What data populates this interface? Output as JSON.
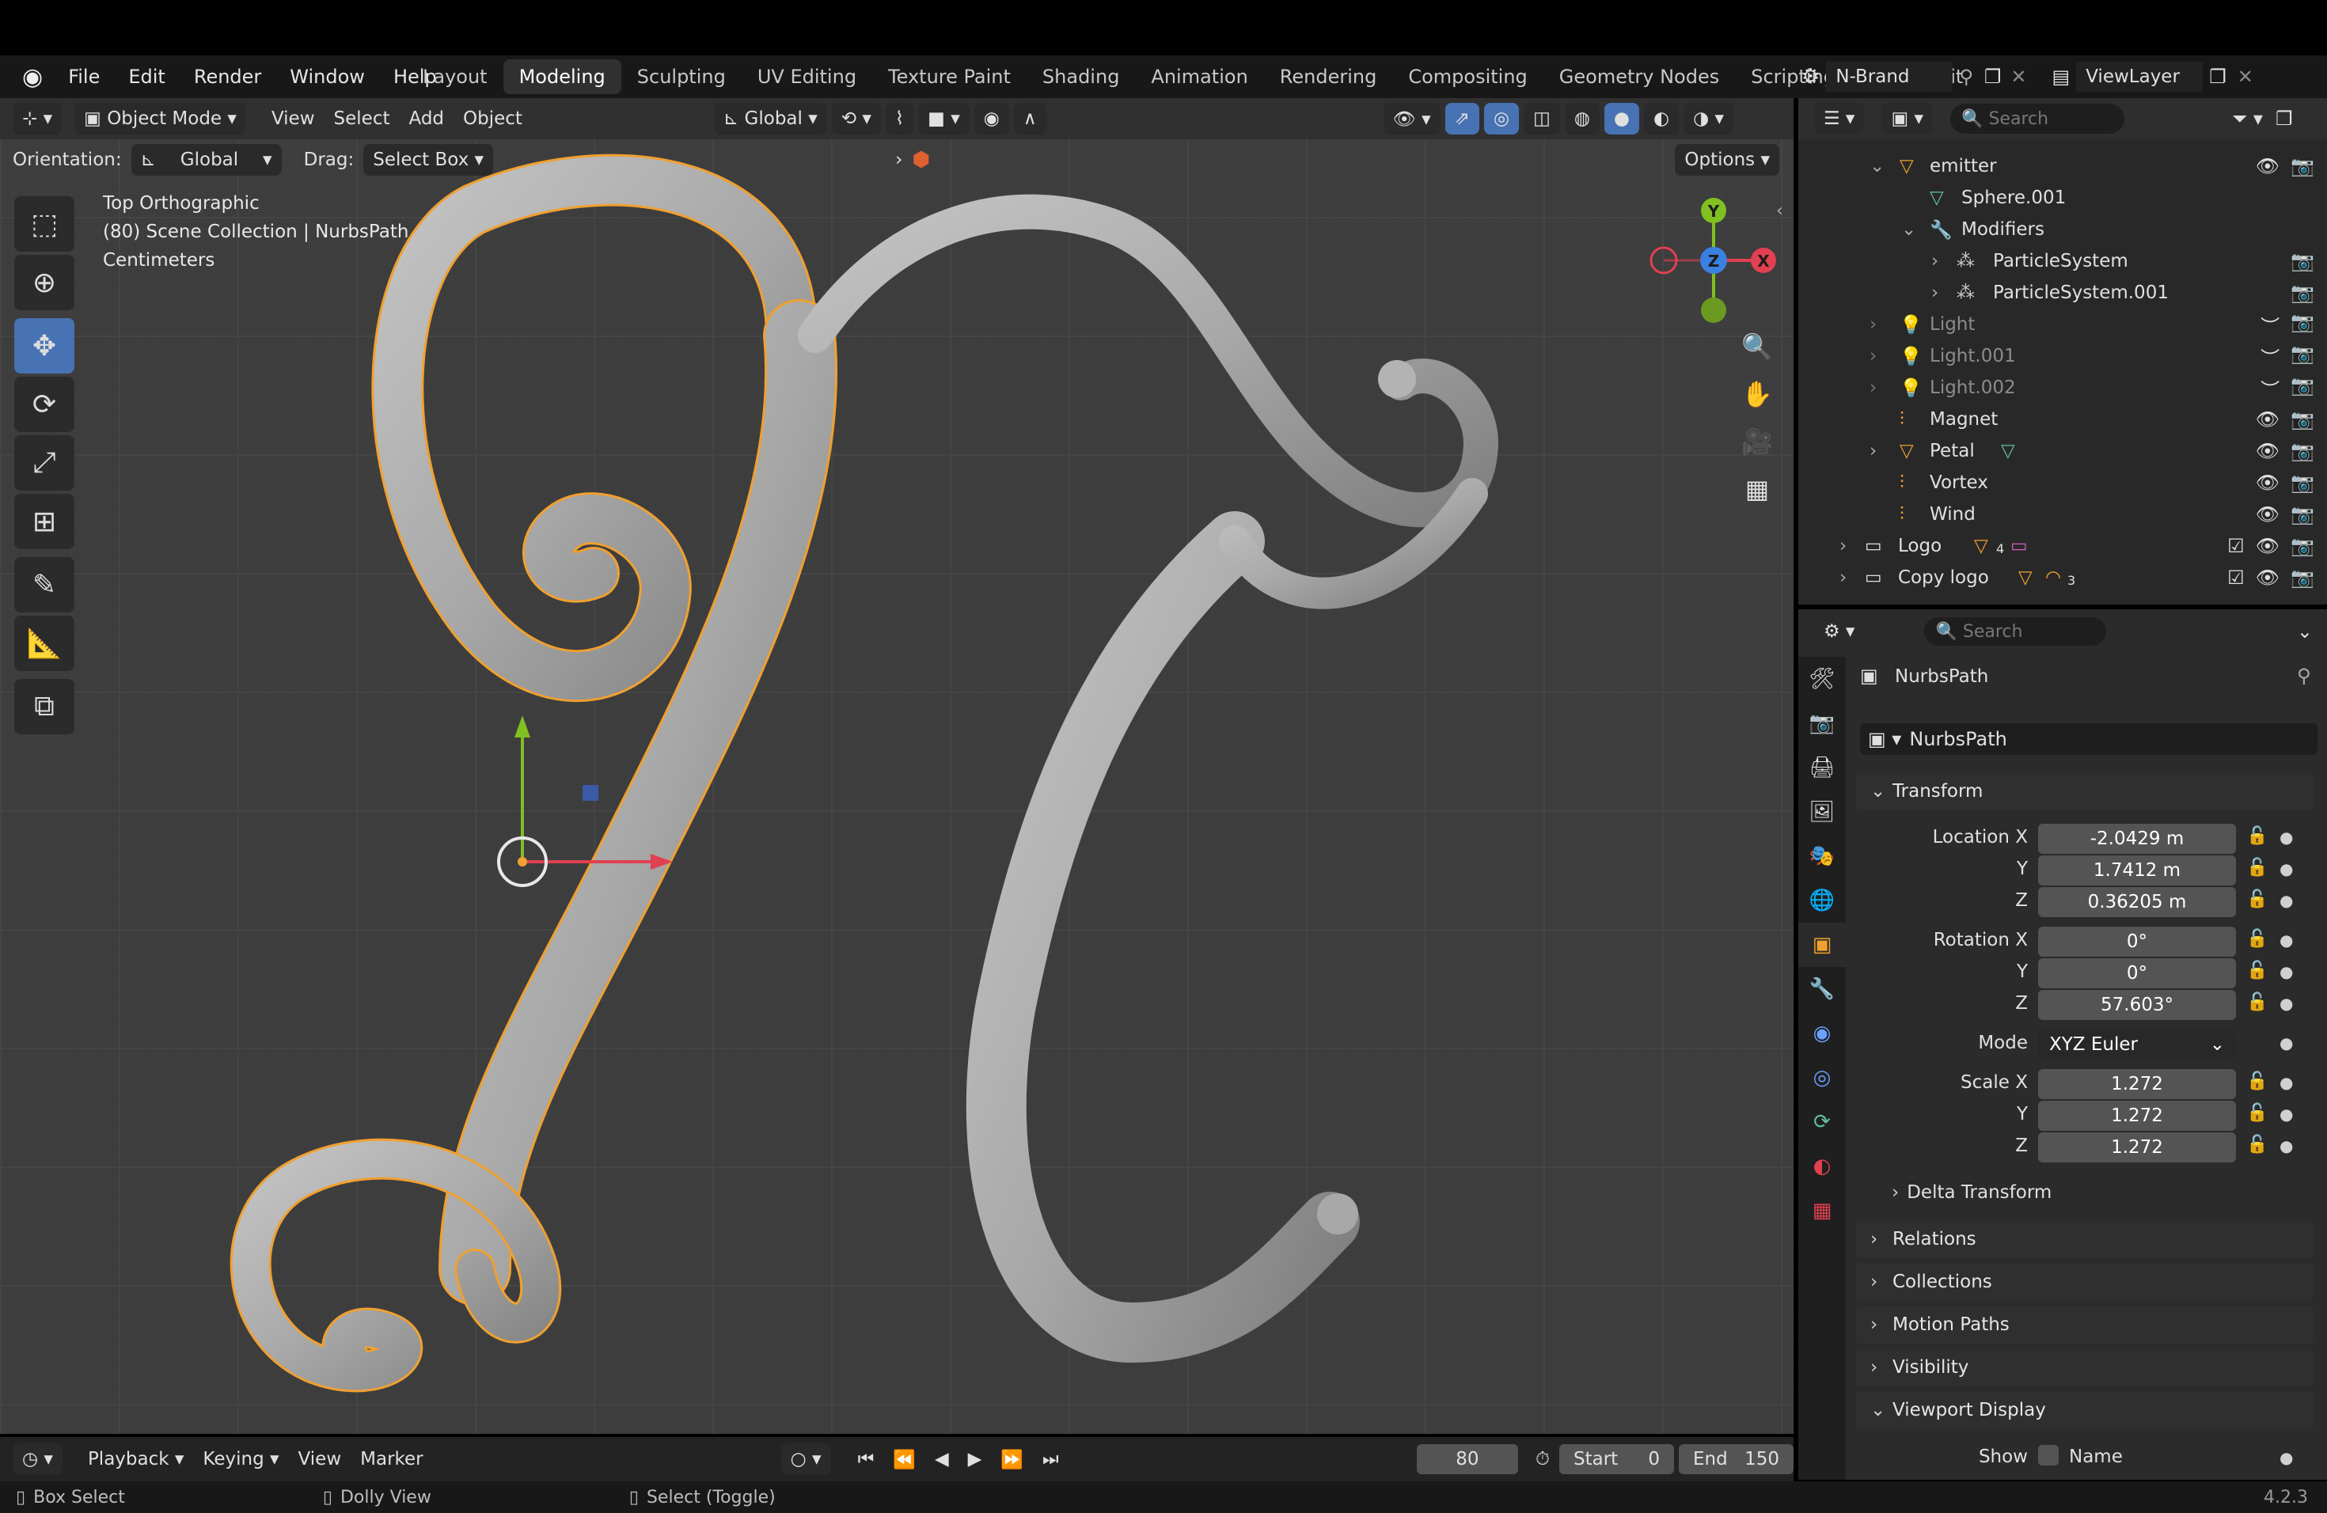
{
  "menus": [
    "File",
    "Edit",
    "Render",
    "Window",
    "Help"
  ],
  "workspaces": [
    "Layout",
    "Modeling",
    "Sculpting",
    "UV Editing",
    "Texture Paint",
    "Shading",
    "Animation",
    "Rendering",
    "Compositing",
    "Geometry Nodes",
    "Scripting",
    "Video Edit"
  ],
  "active_workspace": "Modeling",
  "scene": {
    "name": "N-Brand",
    "view_layer": "ViewLayer"
  },
  "viewport_header": {
    "mode": "Object Mode",
    "menus": [
      "View",
      "Select",
      "Add",
      "Object"
    ],
    "transform_orientation": "Global",
    "orientation_label": "Orientation:",
    "orientation_value": "Global",
    "drag_label": "Drag:",
    "drag_value": "Select Box",
    "options": "Options"
  },
  "viewport_info": {
    "view": "Top Orthographic",
    "collection": "(80) Scene Collection | NurbsPath",
    "units": "Centimeters"
  },
  "gizmo": {
    "y": "Y",
    "z": "Z",
    "x": "X"
  },
  "outliner": {
    "search_placeholder": "Search",
    "rows": [
      {
        "label": "emitter",
        "icon": "mesh-triangle-icon"
      },
      {
        "label": "Sphere.001",
        "icon": "mesh-data-icon"
      },
      {
        "label": "Modifiers",
        "icon": "wrench-icon"
      },
      {
        "label": "ParticleSystem",
        "icon": "particles-icon"
      },
      {
        "label": "ParticleSystem.001",
        "icon": "particles-icon"
      },
      {
        "label": "Light",
        "icon": "light-icon"
      },
      {
        "label": "Light.001",
        "icon": "light-icon"
      },
      {
        "label": "Light.002",
        "icon": "light-icon"
      },
      {
        "label": "Magnet",
        "icon": "force-field-icon"
      },
      {
        "label": "Petal",
        "icon": "mesh-triangle-icon"
      },
      {
        "label": "Vortex",
        "icon": "force-field-icon"
      },
      {
        "label": "Wind",
        "icon": "force-field-icon"
      },
      {
        "label": "Logo",
        "icon": "collection-icon",
        "badge": "4"
      },
      {
        "label": "Copy logo",
        "icon": "collection-icon",
        "badge": "3"
      }
    ]
  },
  "properties": {
    "search_placeholder": "Search",
    "object_name": "NurbsPath",
    "data_name": "NurbsPath",
    "transform_label": "Transform",
    "location": {
      "label_x": "Location X",
      "label_y": "Y",
      "label_z": "Z",
      "x": "-2.0429 m",
      "y": "1.7412 m",
      "z": "0.36205 m"
    },
    "rotation": {
      "label_x": "Rotation X",
      "label_y": "Y",
      "label_z": "Z",
      "x": "0°",
      "y": "0°",
      "z": "57.603°"
    },
    "mode_label": "Mode",
    "mode_value": "XYZ Euler",
    "scale": {
      "label_x": "Scale X",
      "label_y": "Y",
      "label_z": "Z",
      "x": "1.272",
      "y": "1.272",
      "z": "1.272"
    },
    "delta_transform": "Delta Transform",
    "panels": [
      "Relations",
      "Collections",
      "Motion Paths",
      "Visibility"
    ],
    "viewport_display": "Viewport Display",
    "show_label": "Show",
    "name_label": "Name"
  },
  "timeline": {
    "playback": "Playback",
    "keying": "Keying",
    "view": "View",
    "marker": "Marker",
    "current_frame": "80",
    "start_label": "Start",
    "start": "0",
    "end_label": "End",
    "end": "150"
  },
  "statusbar": {
    "left": "Box Select",
    "middle": "Dolly View",
    "right": "Select (Toggle)",
    "version": "4.2.3"
  },
  "colors": {
    "accent_blue": "#4772b3",
    "selection_orange": "#f0a030",
    "axis_x": "#e04050",
    "axis_y": "#80c020",
    "axis_z": "#3a80e0"
  }
}
